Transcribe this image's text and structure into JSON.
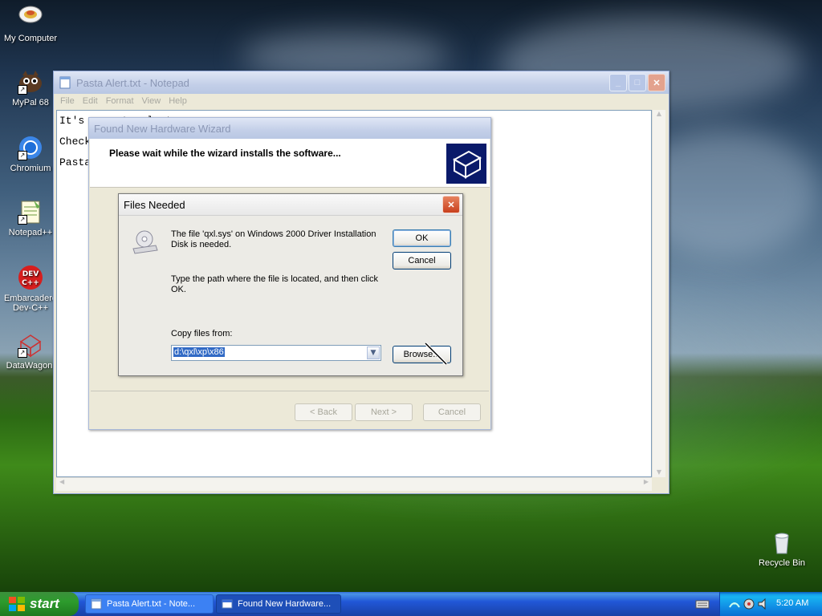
{
  "desktop": {
    "icons": [
      {
        "label": "My Computer",
        "icon": "my-computer-icon"
      },
      {
        "label": "MyPal 68",
        "icon": "mypal-icon"
      },
      {
        "label": "Chromium",
        "icon": "chromium-icon"
      },
      {
        "label": "Notepad++",
        "icon": "notepadpp-icon"
      },
      {
        "label": "Embarcadero Dev-C++",
        "icon": "devcpp-icon",
        "line1": "Embarcadero",
        "line2": "Dev-C++"
      },
      {
        "label": "DataWagon.",
        "icon": "datawagon-icon"
      },
      {
        "label": "Recycle Bin",
        "icon": "recycle-bin-icon"
      }
    ]
  },
  "notepad": {
    "title": "Pasta Alert.txt - Notepad",
    "menu": [
      "File",
      "Edit",
      "Format",
      "View",
      "Help"
    ],
    "lines": [
      "It's a pasta alert",
      "Check",
      "Pasta"
    ]
  },
  "wizard": {
    "title": "Found New Hardware Wizard",
    "heading": "Please wait while the wizard installs the software...",
    "back_label": "< Back",
    "next_label": "Next >",
    "cancel_label": "Cancel"
  },
  "files_needed": {
    "title": "Files Needed",
    "message1": "The file 'qxl.sys' on Windows 2000 Driver Installation Disk is needed.",
    "message2": "Type the path where the file is located, and then click OK.",
    "copy_label": "Copy files from:",
    "path_value": "d:\\qxl\\xp\\x86",
    "ok_label": "OK",
    "cancel_label": "Cancel",
    "browse_label": "Browse..."
  },
  "taskbar": {
    "start_label": "start",
    "tasks": [
      {
        "label": "Pasta Alert.txt - Note...",
        "active": false
      },
      {
        "label": "Found New Hardware...",
        "active": true
      }
    ],
    "clock": "5:20 AM"
  }
}
